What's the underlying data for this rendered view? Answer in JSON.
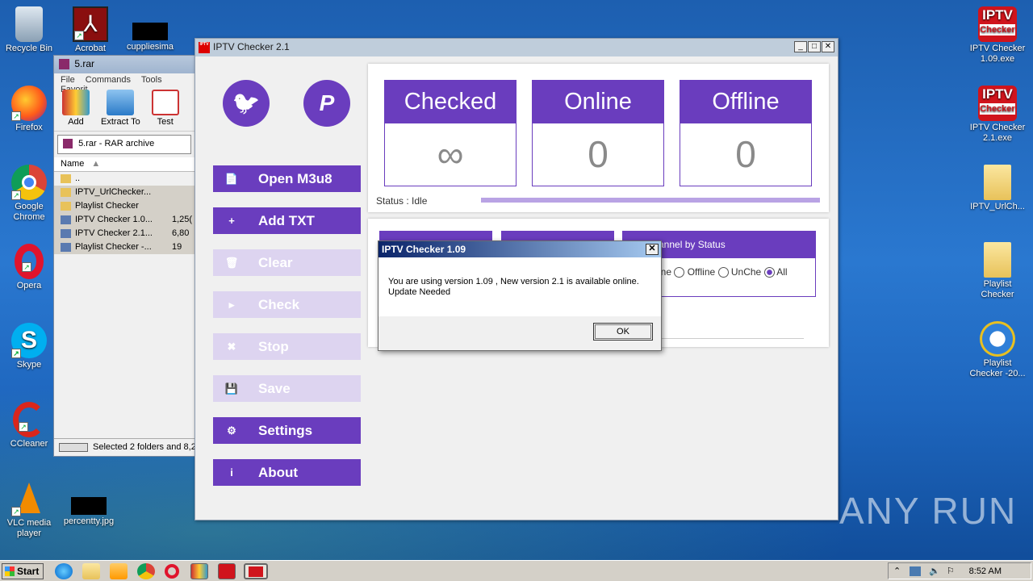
{
  "desktop": {
    "left_icons": [
      {
        "label": "Recycle Bin"
      },
      {
        "label": "Acrobat"
      },
      {
        "label": "cuppliesima"
      },
      {
        "label": "Firefox"
      },
      {
        "label": "Google Chrome"
      },
      {
        "label": "Opera"
      },
      {
        "label": "Skype"
      },
      {
        "label": "CCleaner"
      },
      {
        "label": "VLC media player"
      },
      {
        "label": "percentty.jpg"
      }
    ],
    "right_icons": [
      {
        "label": "IPTV Checker 1.09.exe",
        "badge_top": "IPTV",
        "badge_bottom": "Checker"
      },
      {
        "label": "IPTV Checker 2.1.exe",
        "badge_top": "IPTV",
        "badge_bottom": "Checker"
      },
      {
        "label": "IPTV_UrlCh..."
      },
      {
        "label": "Playlist Checker"
      },
      {
        "label": "Playlist Checker -20..."
      }
    ],
    "watermark": "ANY RUN"
  },
  "rar": {
    "title": "5.rar",
    "menu": [
      "File",
      "Commands",
      "Tools",
      "Favorit"
    ],
    "tools": [
      "Add",
      "Extract To",
      "Test"
    ],
    "path": "5.rar - RAR archive",
    "col_name": "Name",
    "rows": [
      {
        "name": "..",
        "size": ""
      },
      {
        "name": "IPTV_UrlChecker...",
        "size": ""
      },
      {
        "name": "Playlist Checker",
        "size": ""
      },
      {
        "name": "IPTV Checker 1.0...",
        "size": "1,25("
      },
      {
        "name": "IPTV Checker 2.1...",
        "size": "6,80"
      },
      {
        "name": "Playlist Checker -...",
        "size": "19"
      }
    ],
    "status": "Selected 2 folders and 8,2"
  },
  "iptv": {
    "title": "IPTV Checker 2.1",
    "icon_text": "IPTV",
    "twitter_glyph": "🐦",
    "paypal_glyph": "P",
    "nav": [
      {
        "label": "Open M3u8",
        "icon": "📄",
        "enabled": true
      },
      {
        "label": "Add TXT",
        "icon": "+",
        "enabled": true
      },
      {
        "label": "Clear",
        "icon": "🗑",
        "enabled": false
      },
      {
        "label": "Check",
        "icon": "▸",
        "enabled": false
      },
      {
        "label": "Stop",
        "icon": "✖",
        "enabled": false
      },
      {
        "label": "Save",
        "icon": "💾",
        "enabled": false
      },
      {
        "label": "Settings",
        "icon": "⚙",
        "enabled": true
      },
      {
        "label": "About",
        "icon": "i",
        "enabled": true
      }
    ],
    "stats": [
      {
        "label": "Checked",
        "value": "∞"
      },
      {
        "label": "Online",
        "value": "0"
      },
      {
        "label": "Offline",
        "value": "0"
      }
    ],
    "status": "Status : Idle",
    "progress": 1.0,
    "filter_header": "annel by Status",
    "filters": [
      {
        "label": "ine",
        "checked": false
      },
      {
        "label": "Offline",
        "checked": false
      },
      {
        "label": "UnChe",
        "checked": false
      },
      {
        "label": "All",
        "checked": true
      }
    ]
  },
  "dialog": {
    "title": "IPTV Checker 1.09",
    "line1": "You are using version 1.09 , New version 2.1 is available online.",
    "line2": "Update Needed",
    "ok": "OK"
  },
  "taskbar": {
    "start": "Start",
    "clock": "8:52 AM"
  },
  "colors": {
    "accent": "#6a3dbe",
    "accent_disabled": "#ddd4f0",
    "progress": "#b9a3e4"
  }
}
